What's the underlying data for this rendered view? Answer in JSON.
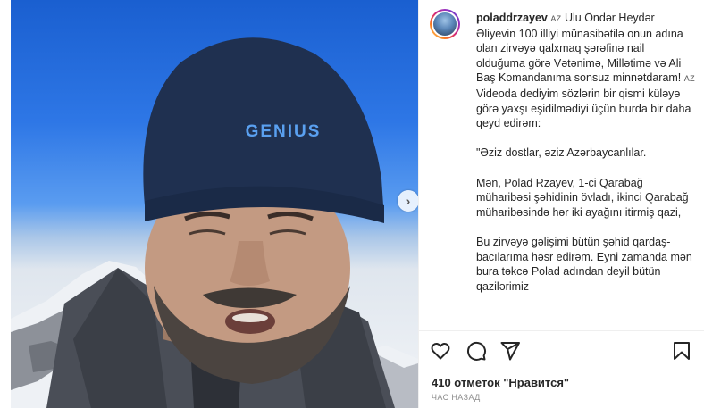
{
  "post": {
    "username": "poladdrzayev",
    "nav_next_icon": "›",
    "caption": {
      "flag1": "AZ",
      "line1": "Ulu Öndər Heydər Əliyevin 100 illiyi münasibətilə onun adına olan zirvəyə qalxmaq şərəfinə nail olduğuma görə Vətənimə, Millətimə və Ali Baş Komandanıma sonsuz minnətdaram!",
      "flag2": "AZ",
      "line2": "Videoda dediyim sözlərin bir qismi küləyə görə yaxşı eşidilmədiyi üçün burda bir daha qeyd edirəm:",
      "quote1": "\"Əziz dostlar, əziz Azərbaycanlılar.",
      "para2": "Mən, Polad Rzayev, 1-ci Qarabağ müharibəsi şəhidinin övladı, ikinci Qarabağ müharibəsində hər iki ayağını itirmiş qazi,",
      "para3": "Bu zirvəyə gəlişimi bütün şəhid qardaş-bacılarıma həsr edirəm. Eyni zamanda mən bura təkcə Polad adından deyil bütün qazilərimiz"
    },
    "hat_text": "GENIUS",
    "likes": "410 отметок \"Нравится\"",
    "time": "ЧАС НАЗАД",
    "icons": [
      "heart-icon",
      "comment-icon",
      "share-icon",
      "bookmark-icon"
    ]
  }
}
